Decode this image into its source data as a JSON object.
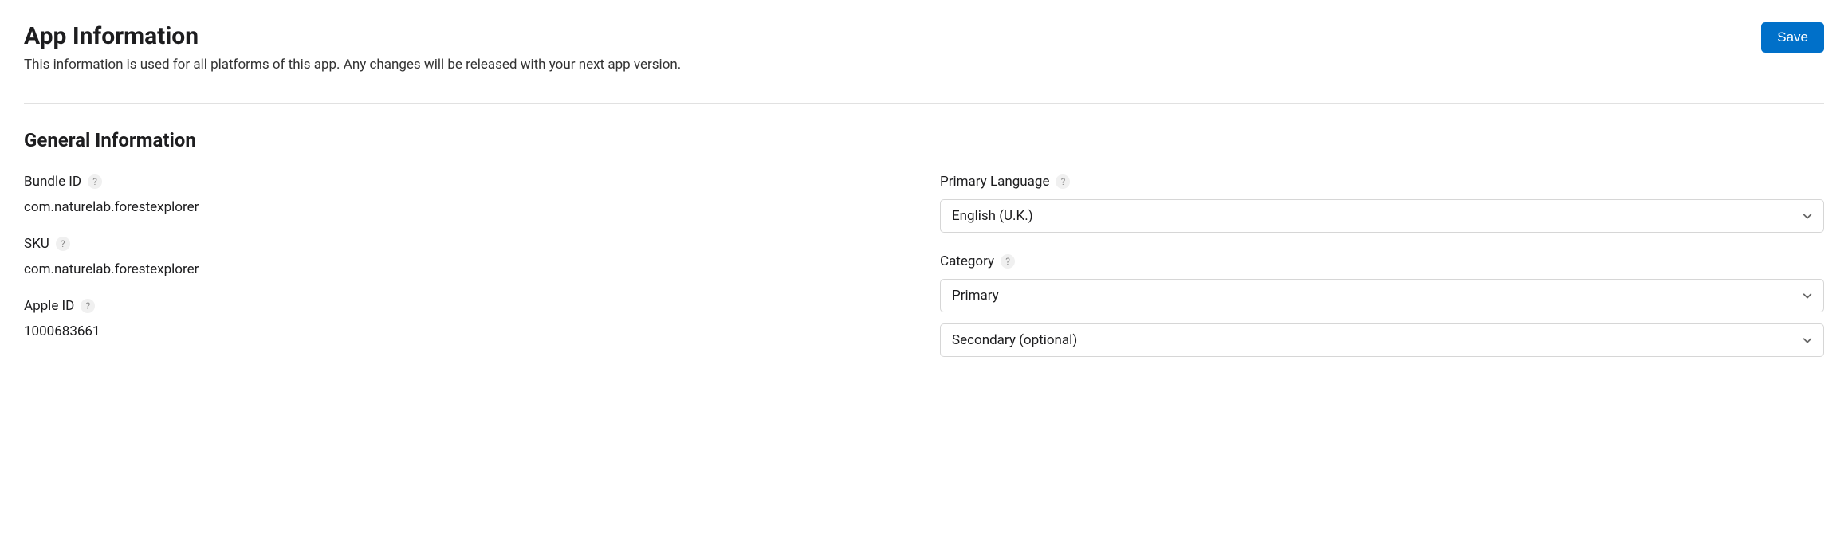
{
  "header": {
    "title": "App Information",
    "description": "This information is used for all platforms of this app. Any changes will be released with your next app version.",
    "save_label": "Save"
  },
  "section": {
    "title": "General Information"
  },
  "left": {
    "bundle_id": {
      "label": "Bundle ID",
      "value": "com.naturelab.forestexplorer"
    },
    "sku": {
      "label": "SKU",
      "value": "com.naturelab.forestexplorer"
    },
    "apple_id": {
      "label": "Apple ID",
      "value": "1000683661"
    }
  },
  "right": {
    "primary_language": {
      "label": "Primary Language",
      "value": "English (U.K.)"
    },
    "category": {
      "label": "Category",
      "primary_value": "Primary",
      "secondary_value": "Secondary (optional)"
    }
  },
  "help_glyph": "?"
}
